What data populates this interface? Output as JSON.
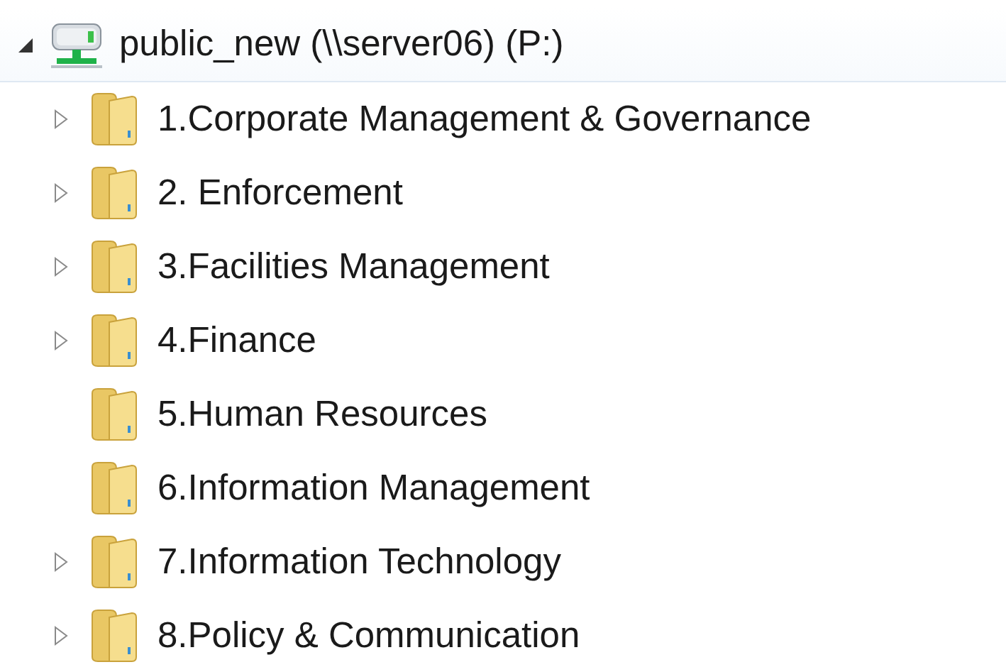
{
  "tree": {
    "label": "public_new (\\\\server06) (P:)",
    "expanded": true,
    "children": [
      {
        "label": "1.Corporate Management & Governance",
        "expandable": true,
        "expanded": false
      },
      {
        "label": "2. Enforcement",
        "expandable": true,
        "expanded": false
      },
      {
        "label": "3.Facilities Management",
        "expandable": true,
        "expanded": false
      },
      {
        "label": "4.Finance",
        "expandable": true,
        "expanded": false
      },
      {
        "label": "5.Human Resources",
        "expandable": false
      },
      {
        "label": "6.Information Management",
        "expandable": false
      },
      {
        "label": "7.Information Technology",
        "expandable": true,
        "expanded": false
      },
      {
        "label": "8.Policy & Communication",
        "expandable": true,
        "expanded": false
      }
    ]
  }
}
